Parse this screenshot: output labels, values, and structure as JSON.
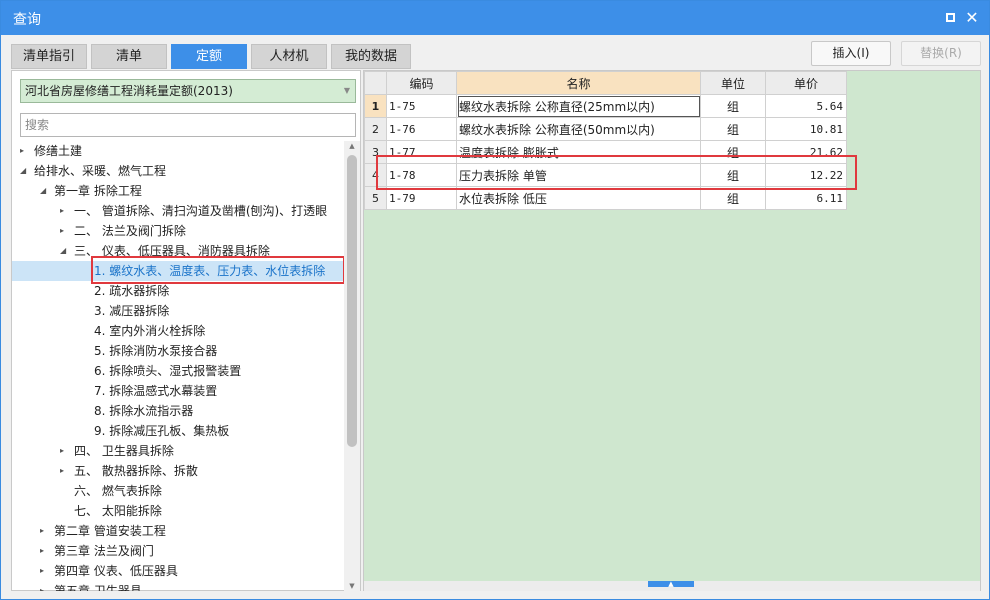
{
  "window": {
    "title": "查询"
  },
  "tabs": [
    {
      "label": "清单指引",
      "active": false
    },
    {
      "label": "清单",
      "active": false
    },
    {
      "label": "定额",
      "active": true
    },
    {
      "label": "人材机",
      "active": false
    },
    {
      "label": "我的数据",
      "active": false
    }
  ],
  "actions": {
    "insert_label": "插入(I)",
    "replace_label": "替换(R)"
  },
  "library": {
    "selected": "河北省房屋修缮工程消耗量定额(2013)"
  },
  "search": {
    "placeholder": "搜索"
  },
  "tree": [
    {
      "label": "修缮土建",
      "toggle": "▸",
      "level": 0
    },
    {
      "label": "给排水、采暖、燃气工程",
      "toggle": "◢",
      "level": 0
    },
    {
      "label": "第一章 拆除工程",
      "toggle": "◢",
      "level": 1
    },
    {
      "label": "一、 管道拆除、清扫沟道及凿槽(刨沟)、打透眼",
      "toggle": "▸",
      "level": 2
    },
    {
      "label": "二、 法兰及阀门拆除",
      "toggle": "▸",
      "level": 2
    },
    {
      "label": "三、 仪表、低压器具、消防器具拆除",
      "toggle": "◢",
      "level": 2
    },
    {
      "label": "1. 螺纹水表、温度表、压力表、水位表拆除",
      "toggle": "",
      "level": 3,
      "selected": true
    },
    {
      "label": "2. 疏水器拆除",
      "toggle": "",
      "level": 3
    },
    {
      "label": "3. 减压器拆除",
      "toggle": "",
      "level": 3
    },
    {
      "label": "4. 室内外消火栓拆除",
      "toggle": "",
      "level": 3
    },
    {
      "label": "5. 拆除消防水泵接合器",
      "toggle": "",
      "level": 3
    },
    {
      "label": "6. 拆除喷头、湿式报警装置",
      "toggle": "",
      "level": 3
    },
    {
      "label": "7. 拆除温感式水幕装置",
      "toggle": "",
      "level": 3
    },
    {
      "label": "8. 拆除水流指示器",
      "toggle": "",
      "level": 3
    },
    {
      "label": "9. 拆除减压孔板、集热板",
      "toggle": "",
      "level": 3
    },
    {
      "label": "四、 卫生器具拆除",
      "toggle": "▸",
      "level": 2
    },
    {
      "label": "五、 散热器拆除、拆散",
      "toggle": "▸",
      "level": 2
    },
    {
      "label": "六、 燃气表拆除",
      "toggle": "",
      "level": 2
    },
    {
      "label": "七、 太阳能拆除",
      "toggle": "",
      "level": 2
    },
    {
      "label": "第二章 管道安装工程",
      "toggle": "▸",
      "level": 1
    },
    {
      "label": "第三章 法兰及阀门",
      "toggle": "▸",
      "level": 1
    },
    {
      "label": "第四章 仪表、低压器具",
      "toggle": "▸",
      "level": 1
    },
    {
      "label": "第五章 卫生器具",
      "toggle": "▸",
      "level": 1
    }
  ],
  "grid": {
    "headers": {
      "code": "编码",
      "name": "名称",
      "unit": "单位",
      "price": "单价"
    },
    "rows": [
      {
        "no": "1",
        "code": "1-75",
        "name": "螺纹水表拆除 公称直径(25mm以内)",
        "unit": "组",
        "price": "5.64",
        "current": true
      },
      {
        "no": "2",
        "code": "1-76",
        "name": "螺纹水表拆除 公称直径(50mm以内)",
        "unit": "组",
        "price": "10.81"
      },
      {
        "no": "3",
        "code": "1-77",
        "name": "温度表拆除 膨胀式",
        "unit": "组",
        "price": "21.62"
      },
      {
        "no": "4",
        "code": "1-78",
        "name": "压力表拆除 单管",
        "unit": "组",
        "price": "12.22"
      },
      {
        "no": "5",
        "code": "1-79",
        "name": "水位表拆除 低压",
        "unit": "组",
        "price": "6.11"
      }
    ]
  },
  "colors": {
    "accent": "#3d8fe8",
    "highlight": "#e0393e",
    "grid_bg": "#cfe7cf",
    "header_active": "#f9e2c0"
  }
}
